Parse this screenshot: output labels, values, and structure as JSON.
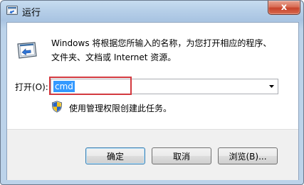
{
  "window": {
    "title": "运行",
    "close_label": "x"
  },
  "description": {
    "line1": "Windows 将根据您所输入的名称，为您打开相应的程序、",
    "line2": "文件夹、文档或 Internet 资源。"
  },
  "open_field": {
    "label": "打开(O):",
    "value": "cmd"
  },
  "admin_note": "使用管理权限创建此任务。",
  "buttons": {
    "ok": "确定",
    "cancel": "取消",
    "browse": "浏览(B)..."
  },
  "colors": {
    "highlight_box": "#d3393f",
    "selection": "#3399ff",
    "close_button": "#c7432b"
  },
  "icons": {
    "title": "run-icon",
    "main": "run-icon",
    "shield": "uac-shield-icon",
    "dropdown": "chevron-down-icon"
  }
}
